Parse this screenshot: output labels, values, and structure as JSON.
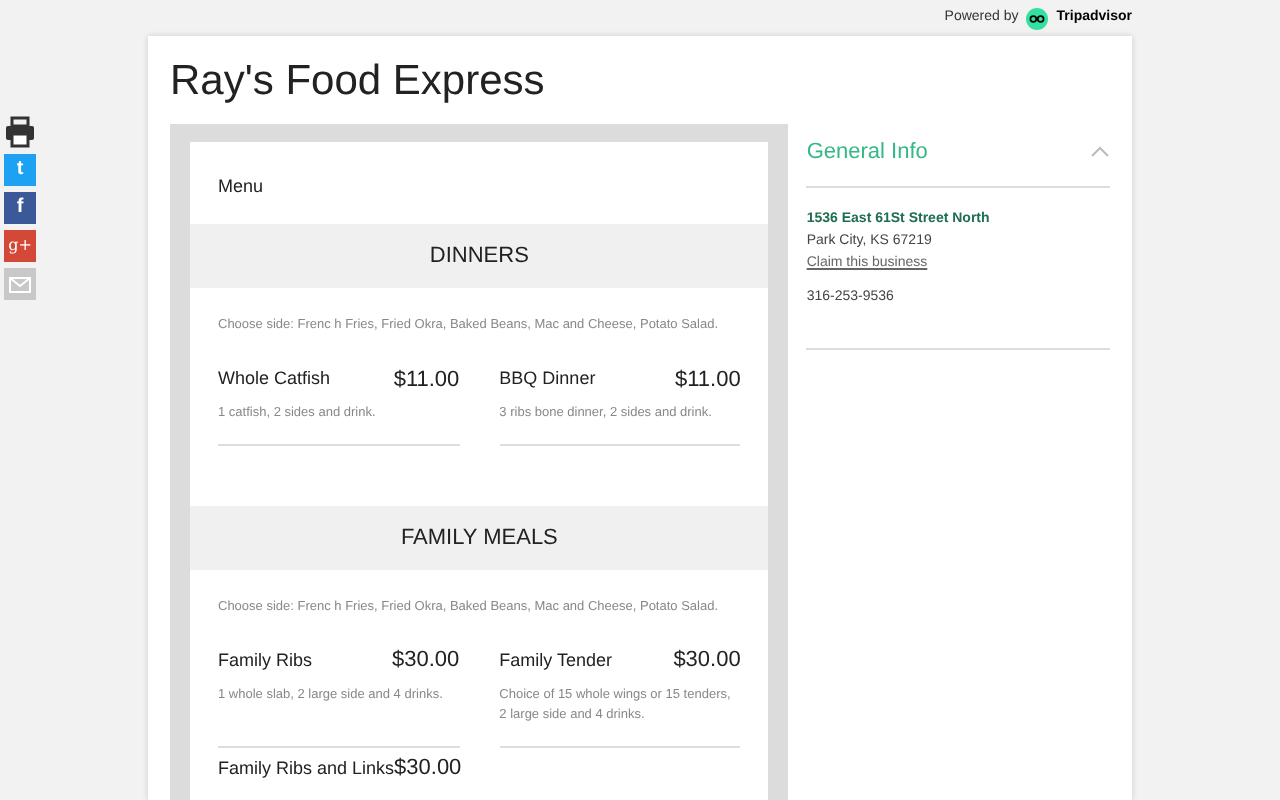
{
  "powered_by": {
    "label": "Powered by",
    "brand": "Tripadvisor"
  },
  "title": "Ray's Food Express",
  "share": [
    {
      "kind": "print"
    },
    {
      "kind": "twitter",
      "label": "t"
    },
    {
      "kind": "facebook",
      "label": "f"
    },
    {
      "kind": "googleplus",
      "label": "g+"
    },
    {
      "kind": "email"
    }
  ],
  "menu": {
    "label": "Menu",
    "sections": [
      {
        "title": "DINNERS",
        "note": "Choose side: Frenc h Fries, Fried Okra, Baked Beans, Mac and Cheese, Potato Salad.",
        "items": [
          {
            "name": "Whole Catfish",
            "price": "$11.00",
            "description": "1 catfish, 2 sides and drink."
          },
          {
            "name": "BBQ Dinner",
            "price": "$11.00",
            "description": "3 ribs bone dinner, 2 sides and drink."
          }
        ]
      },
      {
        "title": "FAMILY MEALS",
        "note": "Choose side: Frenc h Fries, Fried Okra, Baked Beans, Mac and Cheese, Potato Salad.",
        "items": [
          {
            "name": "Family Ribs",
            "price": "$30.00",
            "description": "1 whole slab, 2 large side and 4 drinks."
          },
          {
            "name": "Family Tender",
            "price": "$30.00",
            "description": "Choice of 15 whole wings or 15 tenders, 2 large side and 4 drinks."
          },
          {
            "name": "Family Ribs and Links",
            "price": "$30.00"
          }
        ]
      }
    ]
  },
  "info": {
    "title": "General Info",
    "expanded": true,
    "address": "1536 East 61St Street North",
    "city": "Park City, KS 67219",
    "claim_link": "Claim this business",
    "phone": "316-253-9536"
  }
}
